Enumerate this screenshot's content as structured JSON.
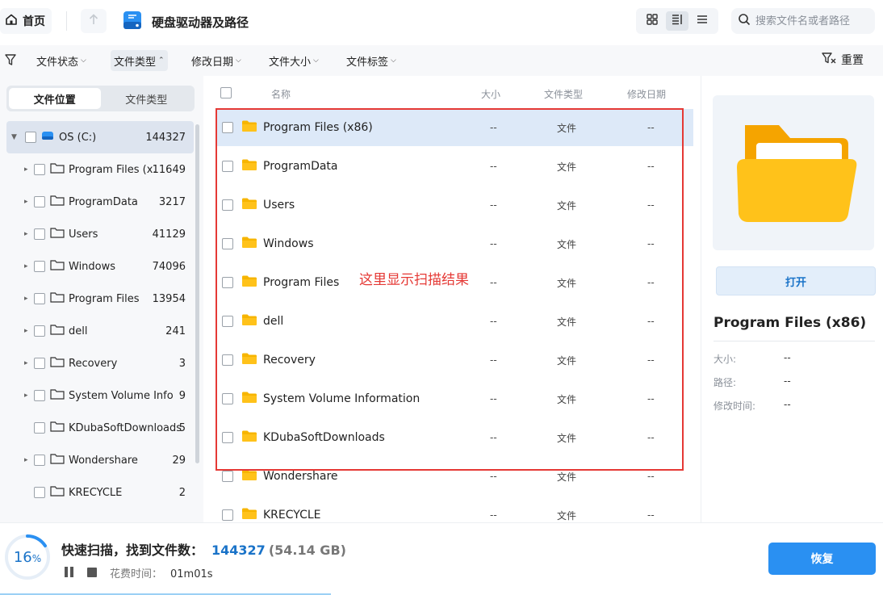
{
  "topbar": {
    "home_label": "首页",
    "drive_title": "硬盘驱动器及路径",
    "search_placeholder": "搜索文件名或者路径"
  },
  "filters": [
    {
      "label": "文件状态",
      "active": false
    },
    {
      "label": "文件类型",
      "active": true
    },
    {
      "label": "修改日期",
      "active": false
    },
    {
      "label": "文件大小",
      "active": false
    },
    {
      "label": "文件标签",
      "active": false
    }
  ],
  "reset_label": "重置",
  "left_tabs": {
    "location": "文件位置",
    "type": "文件类型"
  },
  "tree": {
    "root": {
      "name": "OS (C:)",
      "count": "144327"
    },
    "items": [
      {
        "name": "Program Files (x...",
        "count": "11649",
        "expandable": true
      },
      {
        "name": "ProgramData",
        "count": "3217",
        "expandable": true
      },
      {
        "name": "Users",
        "count": "41129",
        "expandable": true
      },
      {
        "name": "Windows",
        "count": "74096",
        "expandable": true
      },
      {
        "name": "Program Files",
        "count": "13954",
        "expandable": true
      },
      {
        "name": "dell",
        "count": "241",
        "expandable": true
      },
      {
        "name": "Recovery",
        "count": "3",
        "expandable": true
      },
      {
        "name": "System Volume Infor...",
        "count": "9",
        "expandable": true
      },
      {
        "name": "KDubaSoftDownloads",
        "count": "5",
        "expandable": false
      },
      {
        "name": "Wondershare",
        "count": "29",
        "expandable": true
      },
      {
        "name": "KRECYCLE",
        "count": "2",
        "expandable": false
      }
    ]
  },
  "list": {
    "columns": {
      "name": "名称",
      "size": "大小",
      "type": "文件类型",
      "date": "修改日期"
    },
    "rows": [
      {
        "name": "Program Files (x86)",
        "size": "--",
        "type": "文件",
        "date": "--"
      },
      {
        "name": "ProgramData",
        "size": "--",
        "type": "文件",
        "date": "--"
      },
      {
        "name": "Users",
        "size": "--",
        "type": "文件",
        "date": "--"
      },
      {
        "name": "Windows",
        "size": "--",
        "type": "文件",
        "date": "--"
      },
      {
        "name": "Program Files",
        "size": "--",
        "type": "文件",
        "date": "--"
      },
      {
        "name": "dell",
        "size": "--",
        "type": "文件",
        "date": "--"
      },
      {
        "name": "Recovery",
        "size": "--",
        "type": "文件",
        "date": "--"
      },
      {
        "name": "System Volume Information",
        "size": "--",
        "type": "文件",
        "date": "--"
      },
      {
        "name": "KDubaSoftDownloads",
        "size": "--",
        "type": "文件",
        "date": "--"
      },
      {
        "name": "Wondershare",
        "size": "--",
        "type": "文件",
        "date": "--"
      },
      {
        "name": "KRECYCLE",
        "size": "--",
        "type": "文件",
        "date": "--"
      }
    ],
    "annotation": "这里显示扫描结果"
  },
  "detail": {
    "open_label": "打开",
    "name": "Program Files (x86)",
    "size_label": "大小:",
    "size_value": "--",
    "path_label": "路径:",
    "path_value": "--",
    "mtime_label": "修改时间:",
    "mtime_value": "--"
  },
  "scan": {
    "percent": "16",
    "percent_sign": "%",
    "progress": 0.16,
    "status_label": "快速扫描，找到文件数：",
    "found_count": "144327",
    "found_size": "(54.14 GB)",
    "elapsed_label": "花费时间：",
    "elapsed_value": "01m01s",
    "recover_label": "恢复"
  },
  "colors": {
    "accent": "#2a90f2",
    "annotation": "#e53935",
    "folder": "#f7b500"
  }
}
